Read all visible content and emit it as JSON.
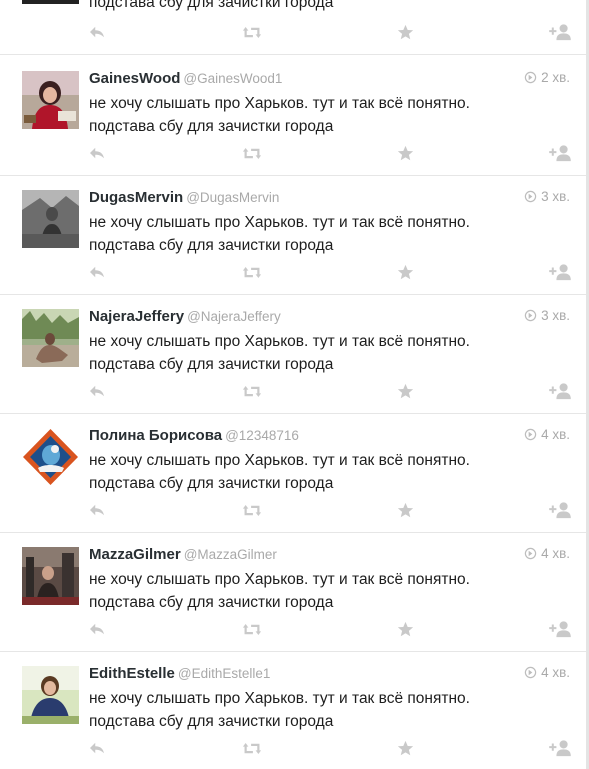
{
  "icons": {
    "reply": "reply-icon",
    "retweet": "retweet-icon",
    "favorite": "star-icon",
    "follow": "follow-user-icon",
    "time": "location-pin-icon"
  },
  "colors": {
    "icon": "#c9c9c9",
    "name": "#292f33",
    "handle": "#a9a9a9",
    "text": "#1e1e1e"
  },
  "tweets": [
    {
      "name": "",
      "handle": "",
      "time": "",
      "line1": "",
      "line2": "подстава сбу для зачистки города"
    },
    {
      "name": "GainesWood",
      "handle": "@GainesWood1",
      "time": "2 хв.",
      "line1": "не хочу слышать про Харьков. тут и так всё понятно.",
      "line2": "подстава сбу для зачистки города"
    },
    {
      "name": "DugasMervin",
      "handle": "@DugasMervin",
      "time": "3 хв.",
      "line1": "не хочу слышать про Харьков. тут и так всё понятно.",
      "line2": "подстава сбу для зачистки города"
    },
    {
      "name": "NajeraJeffery",
      "handle": "@NajeraJeffery",
      "time": "3 хв.",
      "line1": "не хочу слышать про Харьков. тут и так всё понятно.",
      "line2": "подстава сбу для зачистки города"
    },
    {
      "name": "Полина Борисова",
      "handle": "@12348716",
      "time": "4 хв.",
      "line1": "не хочу слышать про Харьков. тут и так всё понятно.",
      "line2": "подстава сбу для зачистки города"
    },
    {
      "name": "MazzaGilmer",
      "handle": "@MazzaGilmer",
      "time": "4 хв.",
      "line1": "не хочу слышать про Харьков. тут и так всё понятно.",
      "line2": "подстава сбу для зачистки города"
    },
    {
      "name": "EdithEstelle",
      "handle": "@EdithEstelle1",
      "time": "4 хв.",
      "line1": "не хочу слышать про Харьков. тут и так всё понятно.",
      "line2": "подстава сбу для зачистки города"
    }
  ]
}
